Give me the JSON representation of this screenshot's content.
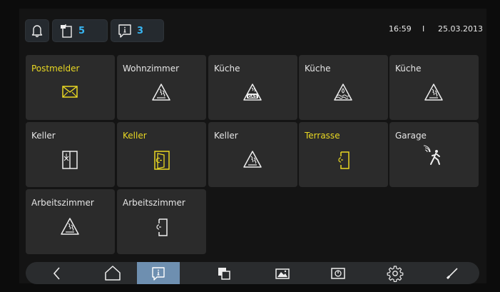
{
  "header": {
    "bell_icon": "bell-icon",
    "messages_count": "5",
    "notices_count": "3",
    "time": "16:59",
    "separator": "I",
    "date": "25.03.2013"
  },
  "tiles": [
    {
      "label": "Postmelder",
      "icon": "mail-icon",
      "alert": true
    },
    {
      "label": "Wohnzimmer",
      "icon": "smoke-alarm-icon",
      "alert": false
    },
    {
      "label": "Küche",
      "icon": "gas-alarm-icon",
      "alert": false
    },
    {
      "label": "Küche",
      "icon": "water-alarm-icon",
      "alert": false
    },
    {
      "label": "Küche",
      "icon": "smoke-alarm-icon",
      "alert": false
    },
    {
      "label": "Keller",
      "icon": "window-open-icon",
      "alert": false
    },
    {
      "label": "Keller",
      "icon": "door-contact-icon",
      "alert": true
    },
    {
      "label": "Keller",
      "icon": "smoke-alarm-icon",
      "alert": false
    },
    {
      "label": "Terrasse",
      "icon": "door-contact-icon",
      "alert": true
    },
    {
      "label": "Garage",
      "icon": "motion-detector-icon",
      "alert": false
    },
    {
      "label": "Arbeitszimmer",
      "icon": "smoke-alarm-icon",
      "alert": false
    },
    {
      "label": "Arbeitszimmer",
      "icon": "door-contact-icon",
      "alert": false
    }
  ],
  "nav": [
    {
      "icon": "back-icon"
    },
    {
      "icon": "home-icon"
    },
    {
      "icon": "message-icon",
      "active": true
    },
    {
      "icon": "windows-icon"
    },
    {
      "icon": "camera-icon"
    },
    {
      "icon": "power-icon"
    },
    {
      "icon": "settings-icon"
    },
    {
      "icon": "clean-icon"
    }
  ],
  "colors": {
    "accent_blue": "#38b6f2",
    "alert_yellow": "#e9d823",
    "active_nav": "#6e8fb0"
  }
}
